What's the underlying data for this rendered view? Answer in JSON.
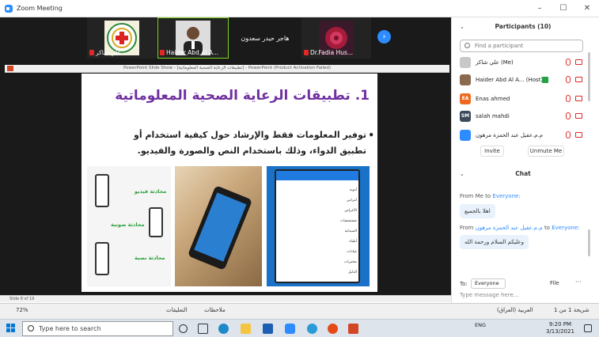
{
  "window": {
    "title": "Zoom Meeting"
  },
  "strip": {
    "tile1_name": "علي شاكر",
    "tile2_name": "Haider Abd Al A...",
    "tile3_name": "هاجر حيدر سعدون",
    "tile4_name": "Dr.Fadia Hus..."
  },
  "ppt": {
    "window_title": "PowerPoint Slide Show - [تطبيقات الرعاية الصحية المعلوماتية] - PowerPoint (Product Activation Failed)"
  },
  "slide": {
    "title": "1. تطبيقات الرعاية الصحية المعلوماتية",
    "bullet": "توفير المعلومات فقط والإرشاد حول كيفية استخدام أو تطبيق الدواء، وذلك باستخدام النص والصورة والفيديو.",
    "img1_labels": [
      "محادثة فيديو",
      "محادثة صوتية",
      "محادثة نصية"
    ],
    "img3_menu": [
      "أدوية",
      "أمراض",
      "الأعراض",
      "مستشفيات",
      "الصيدلية",
      "أطباء",
      "عيادات",
      "مختبرات",
      "الدليل"
    ]
  },
  "status": {
    "slide_info": "Slide 8 of 19",
    "zoom": "72%",
    "comments": "التعليقات",
    "notes": "ملاحظات",
    "slide_count": "شريحة 1 من 1",
    "lang": "العربية (العراق)"
  },
  "participants": {
    "header": "Participants (10)",
    "search_placeholder": "Find a participant",
    "rows": [
      {
        "name": "علي شاكر (Me)",
        "initials": "",
        "color": "#c8c8c8"
      },
      {
        "name": "Haider Abd Al A... (Host)",
        "initials": "",
        "color": "#8a6b4f"
      },
      {
        "name": "Enas ahmed",
        "initials": "EA",
        "color": "#ec6a20"
      },
      {
        "name": "salah mahdi",
        "initials": "SM",
        "color": "#3a4a5a"
      },
      {
        "name": "م.م.عقيل عبد الحمزة مرهون",
        "initials": "",
        "color": "#2d8cff"
      }
    ],
    "invite": "Invite",
    "unmute": "Unmute Me"
  },
  "chat": {
    "header": "Chat",
    "from1": "From Me to",
    "to1": "Everyone:",
    "msg1": "اهلا بالجميع",
    "from2": "From",
    "sender2": "م.م.عقيل عبد الحمزة مرهون",
    "to2_pre": "to",
    "to2": "Everyone:",
    "msg2": "وعليكم السلام ورحمة الله",
    "to_label": "To:",
    "to_value": "Everyone",
    "file": "File",
    "more": "···",
    "input_placeholder": "Type message here..."
  },
  "taskbar": {
    "search": "Type here to search",
    "time": "9:20 PM",
    "date": "3/13/2021",
    "tray_lang": "ENG"
  },
  "colors": {
    "accent": "#2d8cff",
    "slide_title": "#7030a0",
    "muted_red": "#e02828"
  }
}
